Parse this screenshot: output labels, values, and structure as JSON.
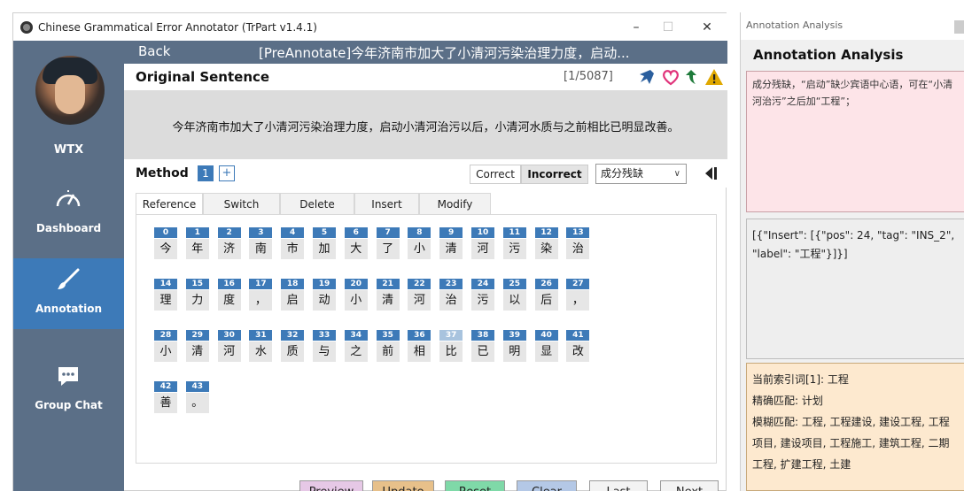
{
  "window": {
    "title": "Chinese Grammatical Error Annotator (TrPart v1.4.1)",
    "minimize": "–",
    "maximize": "☐",
    "close": "✕"
  },
  "sidebar": {
    "username": "WTX",
    "items": [
      {
        "label": "Dashboard",
        "icon": "gauge-icon",
        "active": false
      },
      {
        "label": "Annotation",
        "icon": "brush-icon",
        "active": true
      },
      {
        "label": "Group Chat",
        "icon": "chat-bubble-icon",
        "active": false
      }
    ]
  },
  "header": {
    "back_label": "Back",
    "doc_title": "[PreAnnotate]今年济南市加大了小清河污染治理力度，启动..."
  },
  "original": {
    "label": "Original Sentence",
    "counter": "[1/5087]",
    "sentence": "今年济南市加大了小清河污染治理力度，启动小清河治污以后，小清河水质与之前相比已明显改善。",
    "icons": [
      "pin-icon",
      "heart-icon",
      "arrow-up-icon",
      "warning-icon"
    ],
    "colors": {
      "pin": "#2b5f9e",
      "heart": "#e0337a",
      "arrow": "#1e7a3a",
      "warning": "#e0a800"
    }
  },
  "method": {
    "label": "Method",
    "number": "1",
    "add": "+",
    "correct_label": "Correct",
    "incorrect_label": "Incorrect",
    "error_type": "成分残缺"
  },
  "tabs": [
    "Reference",
    "Switch",
    "Delete",
    "Insert",
    "Modify"
  ],
  "active_tab": "Reference",
  "characters": [
    {
      "i": "0",
      "c": "今"
    },
    {
      "i": "1",
      "c": "年"
    },
    {
      "i": "2",
      "c": "济"
    },
    {
      "i": "3",
      "c": "南"
    },
    {
      "i": "4",
      "c": "市"
    },
    {
      "i": "5",
      "c": "加"
    },
    {
      "i": "6",
      "c": "大"
    },
    {
      "i": "7",
      "c": "了"
    },
    {
      "i": "8",
      "c": "小"
    },
    {
      "i": "9",
      "c": "清"
    },
    {
      "i": "10",
      "c": "河"
    },
    {
      "i": "11",
      "c": "污"
    },
    {
      "i": "12",
      "c": "染"
    },
    {
      "i": "13",
      "c": "治"
    },
    {
      "i": "14",
      "c": "理"
    },
    {
      "i": "15",
      "c": "力"
    },
    {
      "i": "16",
      "c": "度"
    },
    {
      "i": "17",
      "c": "，"
    },
    {
      "i": "18",
      "c": "启"
    },
    {
      "i": "19",
      "c": "动"
    },
    {
      "i": "20",
      "c": "小"
    },
    {
      "i": "21",
      "c": "清"
    },
    {
      "i": "22",
      "c": "河"
    },
    {
      "i": "23",
      "c": "治"
    },
    {
      "i": "24",
      "c": "污"
    },
    {
      "i": "25",
      "c": "以"
    },
    {
      "i": "26",
      "c": "后"
    },
    {
      "i": "27",
      "c": "，"
    },
    {
      "i": "28",
      "c": "小"
    },
    {
      "i": "29",
      "c": "清"
    },
    {
      "i": "30",
      "c": "河"
    },
    {
      "i": "31",
      "c": "水"
    },
    {
      "i": "32",
      "c": "质"
    },
    {
      "i": "33",
      "c": "与"
    },
    {
      "i": "34",
      "c": "之"
    },
    {
      "i": "35",
      "c": "前"
    },
    {
      "i": "36",
      "c": "相"
    },
    {
      "i": "37",
      "c": "比",
      "dim": true
    },
    {
      "i": "38",
      "c": "已"
    },
    {
      "i": "39",
      "c": "明"
    },
    {
      "i": "40",
      "c": "显"
    },
    {
      "i": "41",
      "c": "改"
    },
    {
      "i": "42",
      "c": "善"
    },
    {
      "i": "43",
      "c": "。"
    }
  ],
  "buttons": {
    "preview": "Preview",
    "update": "Update",
    "reset": "Reset",
    "clear": "Clear",
    "last": "Last",
    "next": "Next"
  },
  "button_colors": {
    "preview": "#e6c8e6",
    "update": "#e7c08a",
    "reset": "#7fd9a8",
    "clear": "#b4c8e6",
    "last": "#f3f3f3",
    "next": "#f3f3f3"
  },
  "analysis": {
    "window_title": "Annotation Analysis",
    "heading": "Annotation Analysis",
    "explanation": "成分残缺，“启动”缺少宾语中心语，可在“小清河治污”之后加“工程”；",
    "json_output": "[{\"Insert\": [{\"pos\": 24, \"tag\": \"INS_2\", \"label\": \"工程\"}]}]",
    "index_word": "当前索引词[1]: 工程",
    "exact_match": "精确匹配: 计划",
    "fuzzy_match": "模糊匹配: 工程, 工程建设, 建设工程, 工程项目, 建设项目, 工程施工, 建筑工程, 二期工程, 扩建工程, 土建"
  }
}
